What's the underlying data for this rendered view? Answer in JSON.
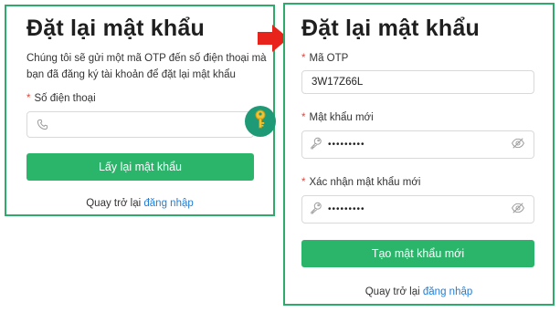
{
  "left_form": {
    "title": "Đặt lại mật khẩu",
    "description_line1": "Chúng tôi sẽ gửi một mã OTP đến số điện thoại mà",
    "description_line2": "bạn đã đăng ký tài khoản để đặt lại mật khẩu",
    "phone_label": "Số điện thoại",
    "phone_value": "",
    "submit_label": "Lấy lại mật khẩu",
    "footer_text": "Quay trở lại",
    "footer_link": "đăng nhập"
  },
  "right_form": {
    "title": "Đặt lại mật khẩu",
    "otp_label": "Mã OTP",
    "otp_value": "3W17Z66L",
    "new_password_label": "Mật khẩu mới",
    "new_password_value": "•••••••••",
    "confirm_password_label": "Xác nhận mật khẩu mới",
    "confirm_password_value": "•••••••••",
    "submit_label": "Tạo mật khẩu mới",
    "footer_text": "Quay trở lại",
    "footer_link": "đăng nhập"
  },
  "required_mark": "*",
  "icons": {
    "phone": "phone-icon",
    "key_badge": "key-icon",
    "lock": "password-key-icon",
    "eye": "eye-slash-icon",
    "arrow": "right-arrow-icon"
  },
  "colors": {
    "accent": "#2ab56a",
    "border": "#2eaa6a",
    "link": "#1f7ed8",
    "required": "#e0483c",
    "arrow": "#e8231b",
    "badge": "#1e9b76"
  }
}
